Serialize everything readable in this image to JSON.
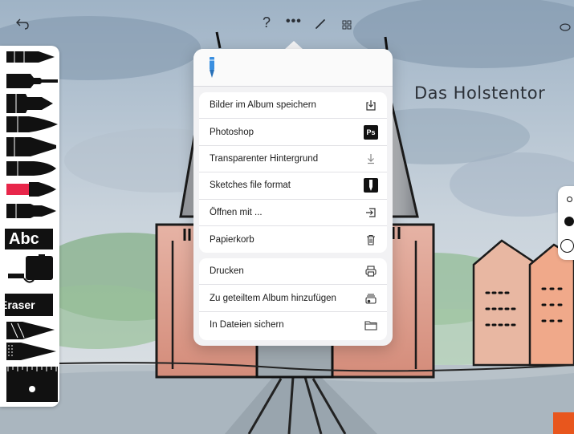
{
  "toolbar": {
    "undo_icon": "undo-icon",
    "help_label": "?",
    "more_label": "•••",
    "pen_icon": "pen-icon",
    "grid_icon": "grid-icon",
    "circle_icon": "circle-icon"
  },
  "sketch": {
    "title": "Das Holstentor"
  },
  "tool_palette": {
    "text_tool_label": "Abc",
    "eraser_label": "Eraser",
    "selected_color": "#e8264a"
  },
  "share_menu": {
    "group_1": [
      {
        "label": "Bilder im Album speichern",
        "icon": "save-to-album-icon"
      },
      {
        "label": "Photoshop",
        "icon": "photoshop-icon",
        "badge": "Ps"
      },
      {
        "label": "Transparenter Hintergrund",
        "icon": "transparent-background-icon"
      },
      {
        "label": "Sketches file format",
        "icon": "sketches-app-icon"
      },
      {
        "label": "Öffnen mit ...",
        "icon": "open-with-icon"
      },
      {
        "label": "Papierkorb",
        "icon": "trash-icon"
      }
    ],
    "group_2": [
      {
        "label": "Drucken",
        "icon": "printer-icon"
      },
      {
        "label": "Zu geteiltem Album hinzufügen",
        "icon": "shared-album-icon"
      },
      {
        "label": "In Dateien sichern",
        "icon": "folder-icon"
      }
    ]
  },
  "colors": {
    "accent_orange": "#e8561d",
    "brush_blue": "#3a8fe0"
  }
}
